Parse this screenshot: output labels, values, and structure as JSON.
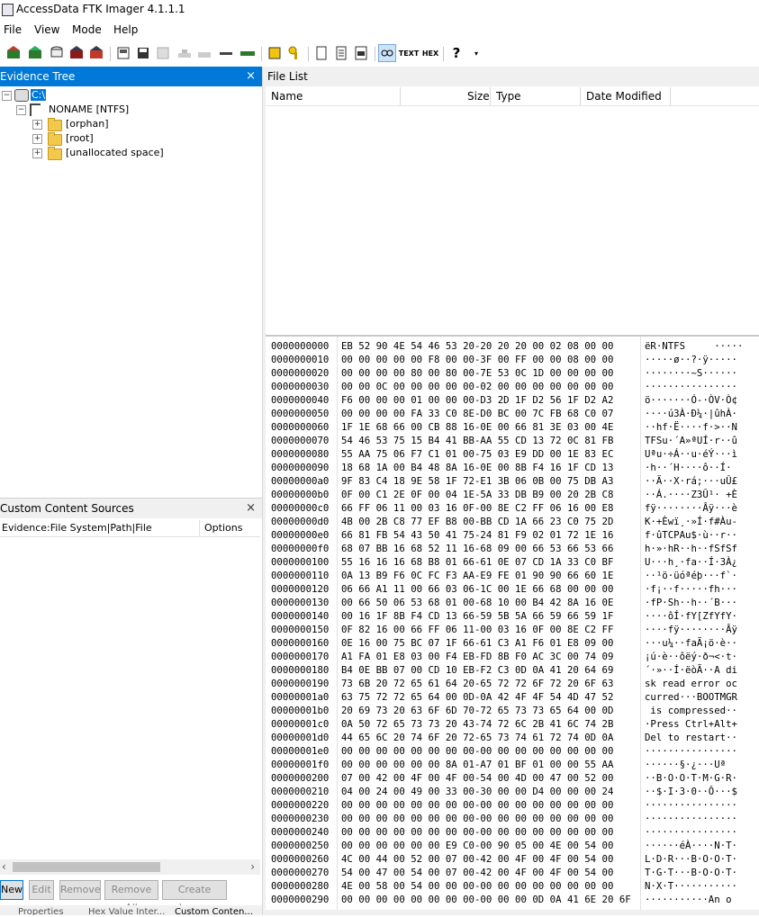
{
  "app": {
    "title": "AccessData FTK Imager 4.1.1.1"
  },
  "menu": [
    "File",
    "View",
    "Mode",
    "Help"
  ],
  "toolbar": {
    "icons": [
      "add-evidence-icon",
      "add-all-evidence-icon",
      "image-mounting-icon",
      "remove-evidence-icon",
      "remove-all-evidence-icon",
      "create-disk-image-icon",
      "export-disk-image-icon",
      "export-logical-image-icon",
      "add-to-custom-content-icon",
      "create-custom-content-image-icon",
      "decrypt-icon",
      "verify-drive-icon",
      "capture-memory-icon",
      "obtain-protected-files-icon",
      "detect-efs-icon",
      "export-files-icon",
      "export-file-hash-list-icon",
      "export-directory-listing-icon",
      "view-auto-icon",
      "view-text-icon",
      "view-hex-icon",
      "help-icon"
    ],
    "text_icon_label": "TEXT",
    "hex_icon_label": "HEX",
    "help_glyph": "?"
  },
  "evidence_tree": {
    "title": "Evidence Tree",
    "close": "×",
    "root": "C:\\",
    "partition": "NONAME [NTFS]",
    "folders": [
      "[orphan]",
      "[root]",
      "[unallocated space]"
    ]
  },
  "file_list": {
    "title": "File List",
    "columns": [
      "Name",
      "Size",
      "Type",
      "Date Modified"
    ]
  },
  "custom_content": {
    "title": "Custom Content Sources",
    "close": "×",
    "col_evidence": "Evidence:File System|Path|File",
    "col_options": "Options",
    "buttons": [
      "New",
      "Edit",
      "Remove",
      "Remove All",
      "Create Image"
    ],
    "tabs": [
      "Properties",
      "Hex Value Inter...",
      "Custom Conten..."
    ]
  },
  "hex": [
    [
      "0000000000",
      "EB 52 90 4E 54 46 53 20-20 20 20 00 02 08 00 00",
      "ëR·NTFS     ·····"
    ],
    [
      "0000000010",
      "00 00 00 00 00 F8 00 00-3F 00 FF 00 00 08 00 00",
      "·····ø··?·ÿ·····"
    ],
    [
      "0000000020",
      "00 00 00 00 80 00 80 00-7E 53 0C 1D 00 00 00 00",
      "········~S······"
    ],
    [
      "0000000030",
      "00 00 0C 00 00 00 00 00-02 00 00 00 00 00 00 00",
      "················"
    ],
    [
      "0000000040",
      "F6 00 00 00 01 00 00 00-D3 2D 1F D2 56 1F D2 A2",
      "ö·······Ó-·ÒV·Ò¢"
    ],
    [
      "0000000050",
      "00 00 00 00 FA 33 C0 8E-D0 BC 00 7C FB 68 C0 07",
      "····ú3À·Ð¼·|ûhÀ·"
    ],
    [
      "0000000060",
      "1F 1E 68 66 00 CB 88 16-0E 00 66 81 3E 03 00 4E",
      "··hf·Ë····f·>··N"
    ],
    [
      "0000000070",
      "54 46 53 75 15 B4 41 BB-AA 55 CD 13 72 0C 81 FB",
      "TFSu·´A»ªUÍ·r··û"
    ],
    [
      "0000000080",
      "55 AA 75 06 F7 C1 01 00-75 03 E9 DD 00 1E 83 EC",
      "Uªu·÷Á··u·éÝ···ì"
    ],
    [
      "0000000090",
      "18 68 1A 00 B4 48 8A 16-0E 00 8B F4 16 1F CD 13",
      "·h··´H····ô··Í·"
    ],
    [
      "00000000a0",
      "9F 83 C4 18 9E 58 1F 72-E1 3B 06 0B 00 75 DB A3",
      "··Ä··X·rá;···uÛ£"
    ],
    [
      "00000000b0",
      "0F 00 C1 2E 0F 00 04 1E-5A 33 DB B9 00 20 2B C8",
      "··Á.····Z3Û¹· +È"
    ],
    [
      "00000000c0",
      "66 FF 06 11 00 03 16 0F-00 8E C2 FF 06 16 00 E8",
      "fÿ········Âÿ···è"
    ],
    [
      "00000000d0",
      "4B 00 2B C8 77 EF B8 00-BB CD 1A 66 23 C0 75 2D",
      "K·+Èwï¸·»Í·f#Àu-"
    ],
    [
      "00000000e0",
      "66 81 FB 54 43 50 41 75-24 81 F9 02 01 72 1E 16",
      "f·ûTCPAu$·ù··r··"
    ],
    [
      "00000000f0",
      "68 07 BB 16 68 52 11 16-68 09 00 66 53 66 53 66",
      "h·»·hR··h··fSfSf"
    ],
    [
      "0000000100",
      "55 16 16 16 68 B8 01 66-61 0E 07 CD 1A 33 C0 BF",
      "U···h¸·fa··Í·3À¿"
    ],
    [
      "0000000110",
      "0A 13 B9 F6 0C FC F3 AA-E9 FE 01 90 90 66 60 1E",
      "··¹ö·üóªéþ···f`·"
    ],
    [
      "0000000120",
      "06 66 A1 11 00 66 03 06-1C 00 1E 66 68 00 00 00",
      "·f¡··f·····fh···"
    ],
    [
      "0000000130",
      "00 66 50 06 53 68 01 00-68 10 00 B4 42 8A 16 0E",
      "·fP·Sh··h··´B···"
    ],
    [
      "0000000140",
      "00 16 1F 8B F4 CD 13 66-59 5B 5A 66 59 66 59 1F",
      "····ôÍ·fY[ZfYfY·"
    ],
    [
      "0000000150",
      "0F 82 16 00 66 FF 06 11-00 03 16 0F 00 8E C2 FF",
      "····fÿ········Âÿ"
    ],
    [
      "0000000160",
      "0E 16 00 75 BC 07 1F 66-61 C3 A1 F6 01 E8 09 00",
      "···u¼··faÃ¡ö·è··"
    ],
    [
      "0000000170",
      "A1 FA 01 E8 03 00 F4 EB-FD 8B F0 AC 3C 00 74 09",
      "¡ú·è··ôëý·ð¬<·t·"
    ],
    [
      "0000000180",
      "B4 0E BB 07 00 CD 10 EB-F2 C3 0D 0A 41 20 64 69",
      "´·»··Í·ëòÃ··A di"
    ],
    [
      "0000000190",
      "73 6B 20 72 65 61 64 20-65 72 72 6F 72 20 6F 63",
      "sk read error oc"
    ],
    [
      "00000001a0",
      "63 75 72 72 65 64 00 0D-0A 42 4F 4F 54 4D 47 52",
      "curred···BOOTMGR"
    ],
    [
      "00000001b0",
      "20 69 73 20 63 6F 6D 70-72 65 73 73 65 64 00 0D",
      " is compressed··"
    ],
    [
      "00000001c0",
      "0A 50 72 65 73 73 20 43-74 72 6C 2B 41 6C 74 2B",
      "·Press Ctrl+Alt+"
    ],
    [
      "00000001d0",
      "44 65 6C 20 74 6F 20 72-65 73 74 61 72 74 0D 0A",
      "Del to restart··"
    ],
    [
      "00000001e0",
      "00 00 00 00 00 00 00 00-00 00 00 00 00 00 00 00",
      "················"
    ],
    [
      "00000001f0",
      "00 00 00 00 00 00 8A 01-A7 01 BF 01 00 00 55 AA",
      "······§·¿···Uª"
    ],
    [
      "0000000200",
      "07 00 42 00 4F 00 4F 00-54 00 4D 00 47 00 52 00",
      "··B·O·O·T·M·G·R·"
    ],
    [
      "0000000210",
      "04 00 24 00 49 00 33 00-30 00 00 D4 00 00 00 24",
      "··$·I·3·0··Ô···$"
    ],
    [
      "0000000220",
      "00 00 00 00 00 00 00 00-00 00 00 00 00 00 00 00",
      "················"
    ],
    [
      "0000000230",
      "00 00 00 00 00 00 00 00-00 00 00 00 00 00 00 00",
      "················"
    ],
    [
      "0000000240",
      "00 00 00 00 00 00 00 00-00 00 00 00 00 00 00 00",
      "················"
    ],
    [
      "0000000250",
      "00 00 00 00 00 00 E9 C0-00 90 05 00 4E 00 54 00",
      "······éÀ····N·T·"
    ],
    [
      "0000000260",
      "4C 00 44 00 52 00 07 00-42 00 4F 00 4F 00 54 00",
      "L·D·R···B·O·O·T·"
    ],
    [
      "0000000270",
      "54 00 47 00 54 00 07 00-42 00 4F 00 4F 00 54 00",
      "T·G·T···B·O·O·T·"
    ],
    [
      "0000000280",
      "4E 00 58 00 54 00 00 00-00 00 00 00 00 00 00 00",
      "N·X·T···········"
    ],
    [
      "0000000290",
      "00 00 00 00 00 00 00 00-00 00 00 0D 0A 41 6E 20 6F",
      "···········An o"
    ]
  ]
}
